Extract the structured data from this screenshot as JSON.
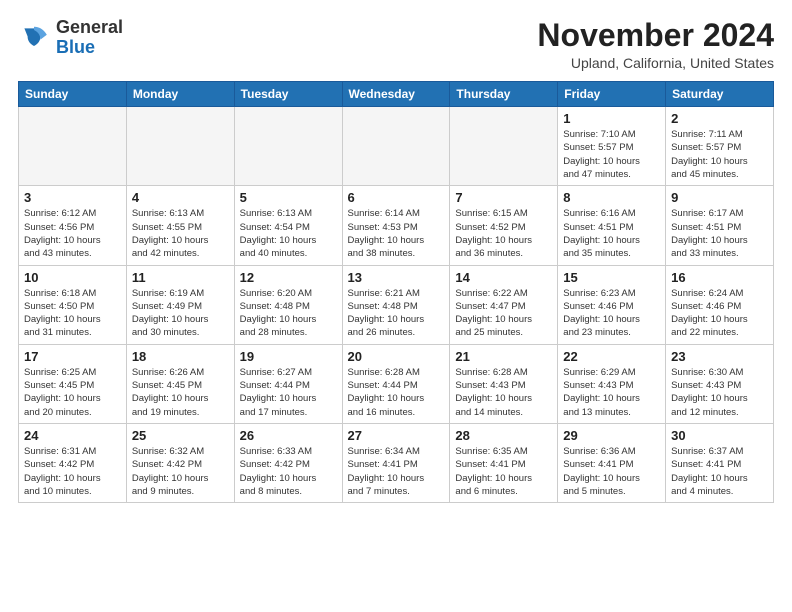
{
  "app": {
    "logo_line1": "General",
    "logo_line2": "Blue"
  },
  "header": {
    "month": "November 2024",
    "location": "Upland, California, United States"
  },
  "weekdays": [
    "Sunday",
    "Monday",
    "Tuesday",
    "Wednesday",
    "Thursday",
    "Friday",
    "Saturday"
  ],
  "weeks": [
    [
      {
        "day": "",
        "info": ""
      },
      {
        "day": "",
        "info": ""
      },
      {
        "day": "",
        "info": ""
      },
      {
        "day": "",
        "info": ""
      },
      {
        "day": "",
        "info": ""
      },
      {
        "day": "1",
        "info": "Sunrise: 7:10 AM\nSunset: 5:57 PM\nDaylight: 10 hours\nand 47 minutes."
      },
      {
        "day": "2",
        "info": "Sunrise: 7:11 AM\nSunset: 5:57 PM\nDaylight: 10 hours\nand 45 minutes."
      }
    ],
    [
      {
        "day": "3",
        "info": "Sunrise: 6:12 AM\nSunset: 4:56 PM\nDaylight: 10 hours\nand 43 minutes."
      },
      {
        "day": "4",
        "info": "Sunrise: 6:13 AM\nSunset: 4:55 PM\nDaylight: 10 hours\nand 42 minutes."
      },
      {
        "day": "5",
        "info": "Sunrise: 6:13 AM\nSunset: 4:54 PM\nDaylight: 10 hours\nand 40 minutes."
      },
      {
        "day": "6",
        "info": "Sunrise: 6:14 AM\nSunset: 4:53 PM\nDaylight: 10 hours\nand 38 minutes."
      },
      {
        "day": "7",
        "info": "Sunrise: 6:15 AM\nSunset: 4:52 PM\nDaylight: 10 hours\nand 36 minutes."
      },
      {
        "day": "8",
        "info": "Sunrise: 6:16 AM\nSunset: 4:51 PM\nDaylight: 10 hours\nand 35 minutes."
      },
      {
        "day": "9",
        "info": "Sunrise: 6:17 AM\nSunset: 4:51 PM\nDaylight: 10 hours\nand 33 minutes."
      }
    ],
    [
      {
        "day": "10",
        "info": "Sunrise: 6:18 AM\nSunset: 4:50 PM\nDaylight: 10 hours\nand 31 minutes."
      },
      {
        "day": "11",
        "info": "Sunrise: 6:19 AM\nSunset: 4:49 PM\nDaylight: 10 hours\nand 30 minutes."
      },
      {
        "day": "12",
        "info": "Sunrise: 6:20 AM\nSunset: 4:48 PM\nDaylight: 10 hours\nand 28 minutes."
      },
      {
        "day": "13",
        "info": "Sunrise: 6:21 AM\nSunset: 4:48 PM\nDaylight: 10 hours\nand 26 minutes."
      },
      {
        "day": "14",
        "info": "Sunrise: 6:22 AM\nSunset: 4:47 PM\nDaylight: 10 hours\nand 25 minutes."
      },
      {
        "day": "15",
        "info": "Sunrise: 6:23 AM\nSunset: 4:46 PM\nDaylight: 10 hours\nand 23 minutes."
      },
      {
        "day": "16",
        "info": "Sunrise: 6:24 AM\nSunset: 4:46 PM\nDaylight: 10 hours\nand 22 minutes."
      }
    ],
    [
      {
        "day": "17",
        "info": "Sunrise: 6:25 AM\nSunset: 4:45 PM\nDaylight: 10 hours\nand 20 minutes."
      },
      {
        "day": "18",
        "info": "Sunrise: 6:26 AM\nSunset: 4:45 PM\nDaylight: 10 hours\nand 19 minutes."
      },
      {
        "day": "19",
        "info": "Sunrise: 6:27 AM\nSunset: 4:44 PM\nDaylight: 10 hours\nand 17 minutes."
      },
      {
        "day": "20",
        "info": "Sunrise: 6:28 AM\nSunset: 4:44 PM\nDaylight: 10 hours\nand 16 minutes."
      },
      {
        "day": "21",
        "info": "Sunrise: 6:28 AM\nSunset: 4:43 PM\nDaylight: 10 hours\nand 14 minutes."
      },
      {
        "day": "22",
        "info": "Sunrise: 6:29 AM\nSunset: 4:43 PM\nDaylight: 10 hours\nand 13 minutes."
      },
      {
        "day": "23",
        "info": "Sunrise: 6:30 AM\nSunset: 4:43 PM\nDaylight: 10 hours\nand 12 minutes."
      }
    ],
    [
      {
        "day": "24",
        "info": "Sunrise: 6:31 AM\nSunset: 4:42 PM\nDaylight: 10 hours\nand 10 minutes."
      },
      {
        "day": "25",
        "info": "Sunrise: 6:32 AM\nSunset: 4:42 PM\nDaylight: 10 hours\nand 9 minutes."
      },
      {
        "day": "26",
        "info": "Sunrise: 6:33 AM\nSunset: 4:42 PM\nDaylight: 10 hours\nand 8 minutes."
      },
      {
        "day": "27",
        "info": "Sunrise: 6:34 AM\nSunset: 4:41 PM\nDaylight: 10 hours\nand 7 minutes."
      },
      {
        "day": "28",
        "info": "Sunrise: 6:35 AM\nSunset: 4:41 PM\nDaylight: 10 hours\nand 6 minutes."
      },
      {
        "day": "29",
        "info": "Sunrise: 6:36 AM\nSunset: 4:41 PM\nDaylight: 10 hours\nand 5 minutes."
      },
      {
        "day": "30",
        "info": "Sunrise: 6:37 AM\nSunset: 4:41 PM\nDaylight: 10 hours\nand 4 minutes."
      }
    ]
  ]
}
